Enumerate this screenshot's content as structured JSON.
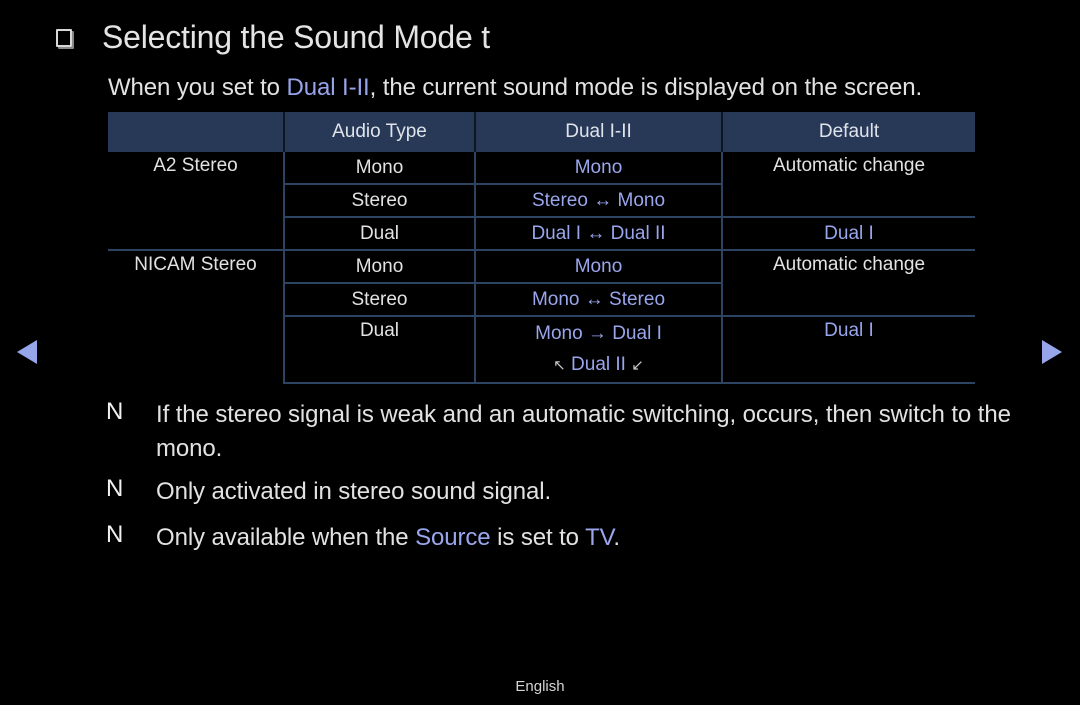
{
  "title": {
    "icon": "checkbox-square-icon",
    "text": "Selecting the Sound Mode t"
  },
  "intro": {
    "before": "When you set to ",
    "highlight": "Dual I-II",
    "after": ", the current sound mode is displayed on the screen."
  },
  "table": {
    "headers": [
      "",
      "Audio Type",
      "Dual I-II",
      "Default"
    ],
    "groups": [
      {
        "source": "A2 Stereo",
        "rows": [
          {
            "audio_type": "Mono",
            "dual": "Mono",
            "default": "Automatic change"
          },
          {
            "audio_type": "Stereo",
            "dual": "Stereo ↔ Mono",
            "default": ""
          },
          {
            "audio_type": "Dual",
            "dual": "Dual I ↔ Dual II",
            "default": "Dual I"
          }
        ]
      },
      {
        "source": "NICAM Stereo",
        "rows": [
          {
            "audio_type": "Mono",
            "dual": "Mono",
            "default": "Automatic change"
          },
          {
            "audio_type": "Stereo",
            "dual": "Mono ↔ Stereo",
            "default": ""
          },
          {
            "audio_type": "Dual",
            "dual": "Mono → Dual I",
            "dual_line2_pre": "↖",
            "dual_line2": "Dual II",
            "dual_line2_post": "↙",
            "default": "Dual I"
          }
        ]
      }
    ]
  },
  "notes": [
    {
      "mark": "N",
      "text": "If the stereo signal is weak and an automatic switching, occurs, then switch to the mono."
    },
    {
      "mark": "N",
      "text": "Only activated in stereo sound signal."
    },
    {
      "mark": "N",
      "before": "Only available when the ",
      "source": "Source",
      "mid": " is set to ",
      "tv": "TV",
      "after": "."
    }
  ],
  "nav": {
    "prev_icon": "triangle-left-icon",
    "next_icon": "triangle-right-icon"
  },
  "footer": {
    "language": "English"
  },
  "colors": {
    "background": "#000000",
    "highlight": "#9aa6ec",
    "header_bg": "#283857",
    "border": "#2c4462",
    "text": "#e2e2e2"
  }
}
